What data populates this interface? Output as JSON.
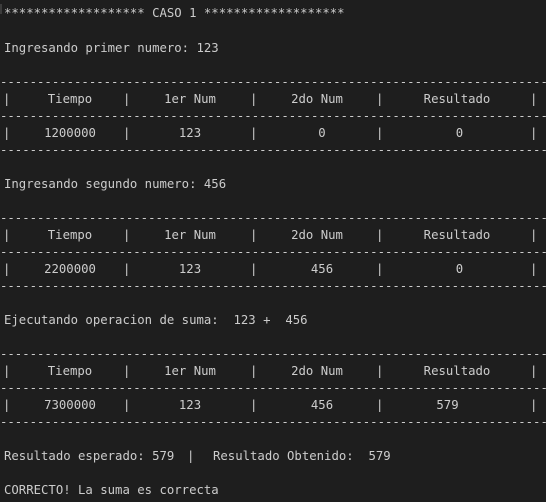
{
  "header": "******************* CASO 1 *******************",
  "step1": "Ingresando primer numero: 123",
  "step2": "Ingresando segundo numero: 456",
  "step3": "Ejecutando operacion de suma:  123 +  456",
  "dashes": "----------------------------------------------------------------------------",
  "separator": "|",
  "columns": [
    "Tiempo",
    "1er Num",
    "2do Num",
    "Resultado"
  ],
  "tables": [
    {
      "row": [
        "1200000",
        "123",
        "0",
        "0"
      ]
    },
    {
      "row": [
        "2200000",
        "123",
        "456",
        "0"
      ]
    },
    {
      "row": [
        "7300000",
        "123",
        "456",
        "579"
      ]
    }
  ],
  "summary": {
    "expected_label": "Resultado esperado: 579",
    "divider": "|",
    "obtained_label": "Resultado Obtenido:  579"
  },
  "final": "CORRECTO! La suma es correcta"
}
